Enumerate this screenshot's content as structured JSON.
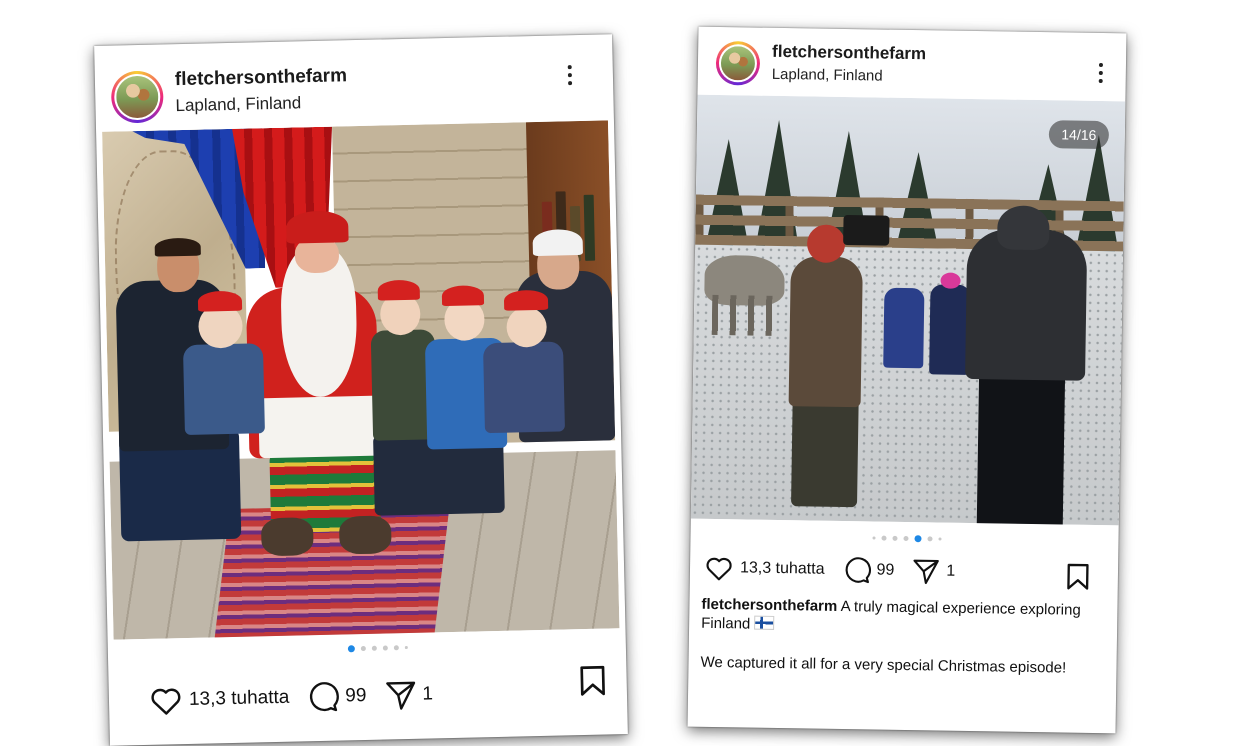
{
  "posts": [
    {
      "username": "fletchersonthefarm",
      "location": "Lapland, Finland",
      "likes": "13,3 tuhatta",
      "comments": "99",
      "shares": "1"
    },
    {
      "username": "fletchersonthefarm",
      "location": "Lapland, Finland",
      "counter": "14/16",
      "likes": "13,3 tuhatta",
      "comments": "99",
      "shares": "1",
      "caption_user": "fletchersonthefarm",
      "caption_line1": "A truly magical experience exploring Finland",
      "caption_line2": "We captured it all for a very special Christmas episode!"
    }
  ],
  "icons": [
    "more-options-icon",
    "heart-icon",
    "comment-icon",
    "share-icon",
    "bookmark-icon",
    "finland-flag-icon"
  ],
  "colors": {
    "active_dot": "#1e88e5",
    "avatar_ring": "#ee2a7b"
  }
}
